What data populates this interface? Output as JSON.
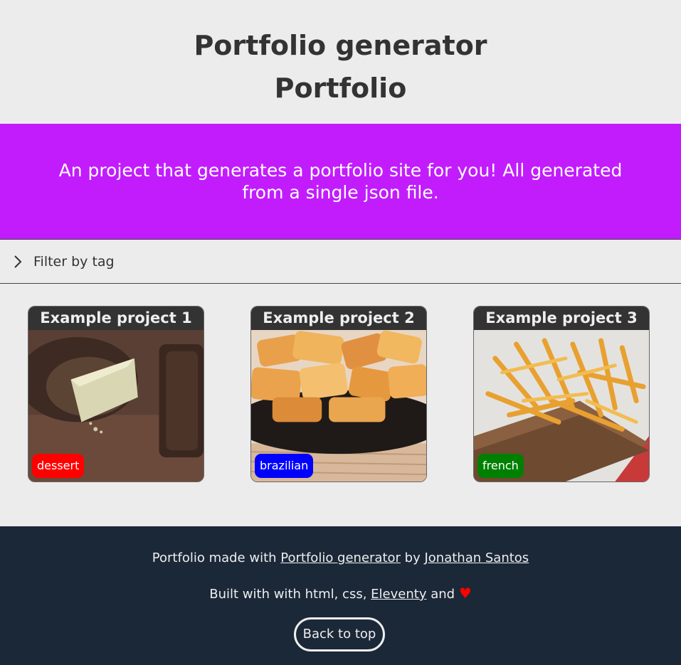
{
  "header": {
    "title": "Portfolio generator",
    "subtitle": "Portfolio"
  },
  "banner": {
    "text": "An project that generates a portfolio site for you! All generated from a single json file.",
    "color": "#c21cfd"
  },
  "filter": {
    "label": "Filter by tag",
    "icon": "chevron-right-icon"
  },
  "projects": [
    {
      "title": "Example project 1",
      "tag": "dessert",
      "tag_color": "#ff0000"
    },
    {
      "title": "Example project 2",
      "tag": "brazilian",
      "tag_color": "#0000ff"
    },
    {
      "title": "Example project 3",
      "tag": "french",
      "tag_color": "#008000"
    }
  ],
  "footer": {
    "made_with": "Portfolio made with",
    "generator_link": "Portfolio generator",
    "by": "by",
    "author_link": "Jonathan Santos",
    "built_with": "Built with with html, css,",
    "eleventy_link": "Eleventy",
    "and": "and",
    "heart": "♥",
    "back_to_top": "Back to top",
    "background": "#1b2838"
  }
}
